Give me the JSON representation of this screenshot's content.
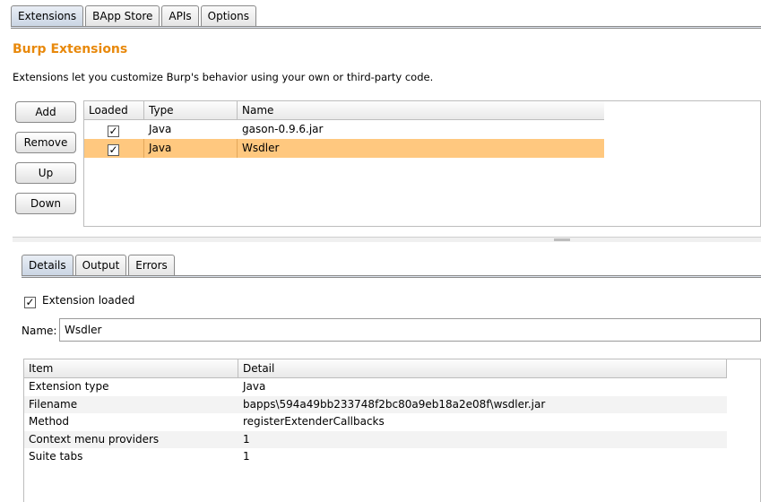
{
  "top_tabs": [
    "Extensions",
    "BApp Store",
    "APIs",
    "Options"
  ],
  "title": "Burp Extensions",
  "description": "Extensions let you customize Burp's behavior using your own or third-party code.",
  "buttons": {
    "add": "Add",
    "remove": "Remove",
    "up": "Up",
    "down": "Down"
  },
  "extensions_table": {
    "headers": [
      "Loaded",
      "Type",
      "Name"
    ],
    "rows": [
      {
        "loaded": true,
        "type": "Java",
        "name": "gason-0.9.6.jar",
        "selected": false
      },
      {
        "loaded": true,
        "type": "Java",
        "name": "Wsdler",
        "selected": true
      }
    ]
  },
  "detail_tabs": [
    "Details",
    "Output",
    "Errors"
  ],
  "extension_loaded": {
    "label": "Extension loaded",
    "checked": true
  },
  "name_field": {
    "label": "Name:",
    "value": "Wsdler"
  },
  "details_table": {
    "headers": [
      "Item",
      "Detail"
    ],
    "rows": [
      [
        "Extension type",
        "Java"
      ],
      [
        "Filename",
        "bapps\\594a49bb233748f2bc80a9eb18a2e08f\\wsdler.jar"
      ],
      [
        "Method",
        "registerExtenderCallbacks"
      ],
      [
        "Context menu providers",
        "1"
      ],
      [
        "Suite tabs",
        "1"
      ]
    ]
  },
  "colors": {
    "accent_title": "#e8890c",
    "selection": "#ffc87f"
  }
}
